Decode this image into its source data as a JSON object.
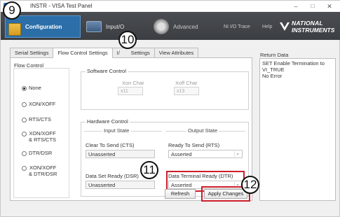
{
  "window": {
    "title": "INSTR - VISA Test Panel",
    "controls": {
      "minimize": "–",
      "maximize": "□",
      "close": "✕"
    }
  },
  "toolbar": {
    "configuration": {
      "label": "Configuration",
      "icon": "configuration-icon"
    },
    "input_output": {
      "label": "Input/O",
      "icon": "input-output-icon"
    },
    "advanced": {
      "label": "Advanced",
      "icon": "advanced-gear-icon"
    },
    "ni_io_trace": "NI I/O Trace",
    "help": "Help",
    "logo": {
      "line1": "NATIONAL",
      "line2": "INSTRUMENTS"
    }
  },
  "tabs": [
    {
      "label": "Serial Settings",
      "active": false
    },
    {
      "label": "Flow Control Settings",
      "active": true
    },
    {
      "label": "I/",
      "active": false
    },
    {
      "label": "Settings",
      "active": false
    },
    {
      "label": "View Attributes",
      "active": false
    }
  ],
  "flow_control": {
    "label": "Flow Control",
    "options": [
      {
        "label": "None",
        "selected": true
      },
      {
        "label": "XON/XOFF",
        "selected": false
      },
      {
        "label": "RTS/CTS",
        "selected": false
      },
      {
        "label_line1": "XON/XOFF",
        "label_line2": "& RTS/CTS",
        "selected": false
      },
      {
        "label": "DTR/DSR",
        "selected": false
      },
      {
        "label_line1": "XON/XOFF",
        "label_line2": "& DTR/DSR",
        "selected": false
      }
    ]
  },
  "software_control": {
    "title": "Software Control",
    "xon_label": "Xon Char",
    "xon_value": "x11",
    "xoff_label": "Xoff Char",
    "xoff_value": "x13"
  },
  "hardware_control": {
    "title": "Hardware Control",
    "input_state": {
      "title": "Input State",
      "cts_label": "Clear To Send (CTS)",
      "cts_value": "Unasserted",
      "dsr_label": "Data Set Ready (DSR)",
      "dsr_value": "Unasserted"
    },
    "output_state": {
      "title": "Output State",
      "rts_label": "Ready To Send (RTS)",
      "rts_value": "Asserted",
      "dtr_label": "Data Terminal Ready (DTR)",
      "dtr_value": "Asserted"
    }
  },
  "buttons": {
    "refresh": "Refresh",
    "apply": "Apply Changes"
  },
  "return_data": {
    "label": "Return Data",
    "lines": [
      "SET Enable Termination to",
      "VI_TRUE",
      "No Error"
    ]
  },
  "callouts": {
    "c9": "9",
    "c10": "10",
    "c11": "11",
    "c12": "12"
  },
  "colors": {
    "highlight": "#cc1f2b",
    "toolbar_bg": "#3b3e42",
    "config_active": "#2b6ea8"
  }
}
